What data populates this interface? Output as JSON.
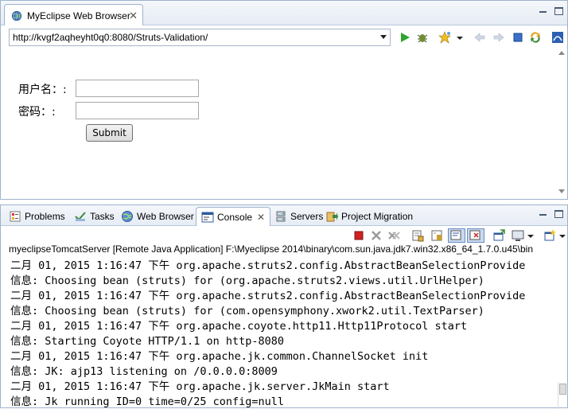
{
  "browser": {
    "tab_title": "MyEclipse Web Browser",
    "close_glyph": "✕",
    "url": "http://kvgf2aqheyht0q0:8080/Struts-Validation/"
  },
  "form": {
    "username_label": "用户名：:",
    "password_label": "密码：:",
    "submit_label": "Submit",
    "username_value": "",
    "password_value": ""
  },
  "bottom_tabs": [
    {
      "label": "Problems",
      "icon": "problems-icon"
    },
    {
      "label": "Tasks",
      "icon": "tasks-icon"
    },
    {
      "label": "Web Browser",
      "icon": "globe-icon"
    },
    {
      "label": "Console",
      "icon": "console-icon",
      "active": true
    },
    {
      "label": "Servers",
      "icon": "servers-icon"
    },
    {
      "label": "Project Migration",
      "icon": "migration-icon"
    }
  ],
  "console": {
    "title": "myeclipseTomcatServer [Remote Java Application] F:\\Myeclipse 2014\\binary\\com.sun.java.jdk7.win32.x86_64_1.7.0.u45\\bin",
    "lines": [
      {
        "text": "二月 01, 2015 1:16:47 下午 org.apache.struts2.config.AbstractBeanSelectionProvide",
        "color": "red"
      },
      {
        "text": "信息: Choosing bean (struts) for (org.apache.struts2.views.util.UrlHelper)",
        "color": "red"
      },
      {
        "text": "二月 01, 2015 1:16:47 下午 org.apache.struts2.config.AbstractBeanSelectionProvide",
        "color": "red"
      },
      {
        "text": "信息: Choosing bean (struts) for (com.opensymphony.xwork2.util.TextParser)",
        "color": "red"
      },
      {
        "text": "二月 01, 2015 1:16:47 下午 org.apache.coyote.http11.Http11Protocol start",
        "color": "red"
      },
      {
        "text": "信息: Starting Coyote HTTP/1.1 on http-8080",
        "color": "red"
      },
      {
        "text": "二月 01, 2015 1:16:47 下午 org.apache.jk.common.ChannelSocket init",
        "color": "red"
      },
      {
        "text": "信息: JK: ajp13 listening on /0.0.0.0:8009",
        "color": "red"
      },
      {
        "text": "二月 01, 2015 1:16:47 下午 org.apache.jk.server.JkMain start",
        "color": "red"
      },
      {
        "text": "信息: Jk running ID=0 time=0/25  config=null",
        "color": "red"
      }
    ]
  },
  "colors": {
    "console_text": "#000000",
    "tab_border": "#9fb3cc",
    "toolbar_bg": "#e6ecf5"
  }
}
